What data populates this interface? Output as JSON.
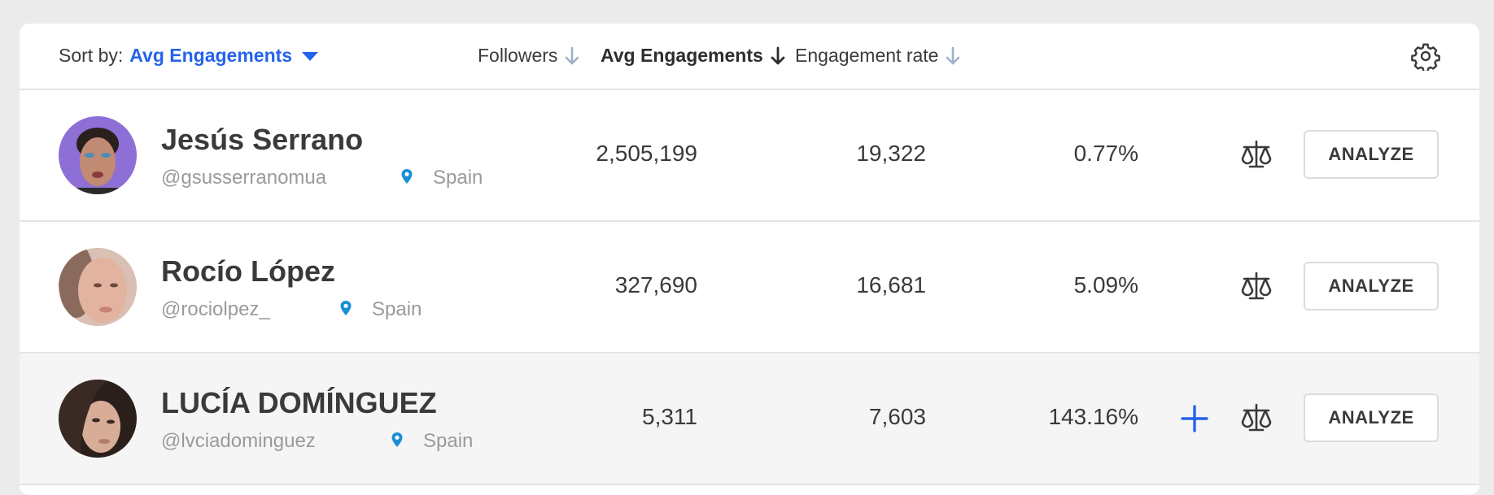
{
  "header": {
    "sort_label": "Sort by:",
    "sort_value": "Avg Engagements",
    "columns": [
      {
        "label": "Followers",
        "active": false
      },
      {
        "label": "Avg Engagements",
        "active": true
      },
      {
        "label": "Engagement rate",
        "active": false
      }
    ],
    "settings_icon": "gear-icon"
  },
  "rows": [
    {
      "name": "Jesús Serrano",
      "handle": "@gsusserranomua",
      "country": "Spain",
      "followers": "2,505,199",
      "avg_engagements": "19,322",
      "engagement_rate": "0.77%",
      "analyze_label": "ANALYZE",
      "show_add": false
    },
    {
      "name": "Rocío López",
      "handle": "@rociolpez_",
      "country": "Spain",
      "followers": "327,690",
      "avg_engagements": "16,681",
      "engagement_rate": "5.09%",
      "analyze_label": "ANALYZE",
      "show_add": false
    },
    {
      "name": "LUCÍA DOMÍNGUEZ",
      "handle": "@lvciadominguez",
      "country": "Spain",
      "followers": "5,311",
      "avg_engagements": "7,603",
      "engagement_rate": "143.16%",
      "analyze_label": "ANALYZE",
      "show_add": true
    }
  ],
  "colors": {
    "accent": "#2563eb",
    "pin": "#1a8fd6",
    "muted_text": "#9a9a9a",
    "row_hover": "#f5f5f5"
  }
}
